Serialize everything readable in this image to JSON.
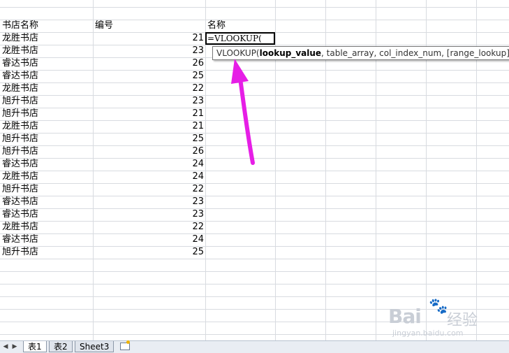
{
  "headers": {
    "col_a": "书店名称",
    "col_b": "编号",
    "col_c": "名称"
  },
  "rows": [
    {
      "name": "龙胜书店",
      "num": "21"
    },
    {
      "name": "龙胜书店",
      "num": "23"
    },
    {
      "name": "睿达书店",
      "num": "26"
    },
    {
      "name": "睿达书店",
      "num": "25"
    },
    {
      "name": "龙胜书店",
      "num": "22"
    },
    {
      "name": "旭升书店",
      "num": "23"
    },
    {
      "name": "旭升书店",
      "num": "21"
    },
    {
      "name": "龙胜书店",
      "num": "21"
    },
    {
      "name": "旭升书店",
      "num": "25"
    },
    {
      "name": "旭升书店",
      "num": "26"
    },
    {
      "name": "睿达书店",
      "num": "24"
    },
    {
      "name": "龙胜书店",
      "num": "24"
    },
    {
      "name": "旭升书店",
      "num": "22"
    },
    {
      "name": "睿达书店",
      "num": "23"
    },
    {
      "name": "睿达书店",
      "num": "23"
    },
    {
      "name": "龙胜书店",
      "num": "22"
    },
    {
      "name": "睿达书店",
      "num": "24"
    },
    {
      "name": "旭升书店",
      "num": "25"
    }
  ],
  "formula": {
    "text": "=VLOOKUP("
  },
  "tooltip": {
    "fn": "VLOOKUP(",
    "arg1": "lookup_value",
    "rest": ", table_array, col_index_num, [range_lookup])"
  },
  "tabs": [
    {
      "label": "表1",
      "active": true
    },
    {
      "label": "表2",
      "active": false
    },
    {
      "label": "Sheet3",
      "active": false
    }
  ],
  "watermark": {
    "main": "Bai",
    "brand": "经验",
    "sub": "jingyan.baidu.com"
  },
  "colors": {
    "arrow": "#e61ee6",
    "grid": "#d8dbe0"
  }
}
